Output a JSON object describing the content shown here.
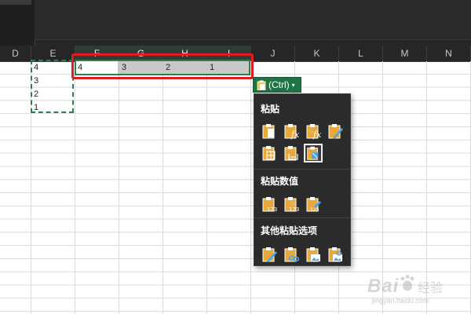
{
  "columns": [
    "D",
    "E",
    "F",
    "G",
    "H",
    "I",
    "J",
    "K",
    "L",
    "M",
    "N"
  ],
  "source_values": [
    "4",
    "3",
    "2",
    "1"
  ],
  "pasted_values": [
    "4",
    "3",
    "2",
    "1"
  ],
  "paste_button": {
    "label": "(Ctrl)",
    "caret": "▾"
  },
  "paste_menu": {
    "section_paste": "粘贴",
    "section_values": "粘贴数值",
    "section_other": "其他粘贴选项",
    "paste_icons": [
      "paste-icon",
      "paste-formulas-icon",
      "paste-formulas-number-format-icon",
      "keep-source-formatting-icon",
      "no-borders-icon",
      "keep-column-widths-icon",
      "transpose-icon"
    ],
    "value_icons": [
      "paste-values-icon",
      "values-number-format-icon",
      "values-source-formatting-icon"
    ],
    "other_icons": [
      "formatting-icon",
      "paste-link-icon",
      "picture-icon",
      "linked-picture-icon"
    ],
    "selected": "transpose-icon"
  },
  "watermark": {
    "brand": "Bai",
    "brand2": "经验",
    "url": "jingyan.baidu.com"
  },
  "colors": {
    "accent": "#217346",
    "highlight_box": "#e11b22",
    "menu_bg": "#2b2b2b"
  }
}
